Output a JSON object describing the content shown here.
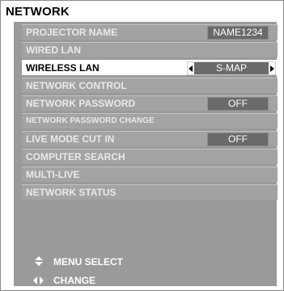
{
  "menu": {
    "title": "NETWORK",
    "items": [
      {
        "label": "PROJECTOR NAME",
        "value": "NAME1234"
      },
      {
        "label": "WIRED LAN"
      },
      {
        "label": "WIRELESS LAN",
        "value": "S-MAP",
        "selected": true
      },
      {
        "label": "NETWORK CONTROL"
      },
      {
        "label": "NETWORK PASSWORD",
        "value": "OFF"
      },
      {
        "label": "NETWORK PASSWORD CHANGE"
      },
      {
        "label": "LIVE MODE CUT IN",
        "value": "OFF"
      },
      {
        "label": "COMPUTER SEARCH"
      },
      {
        "label": "MULTI-LIVE"
      },
      {
        "label": "NETWORK STATUS"
      }
    ]
  },
  "legend": {
    "select": {
      "icon": "up-down-arrows-icon",
      "label": "MENU SELECT"
    },
    "change": {
      "icon": "left-right-arrows-icon",
      "label": "CHANGE"
    }
  },
  "colors": {
    "panel": "#9a9a9a",
    "row": "#a3a3a3",
    "value_box": "#6a6a6a",
    "selected_row": "#ffffff",
    "row_text": "#e9e9e9"
  }
}
